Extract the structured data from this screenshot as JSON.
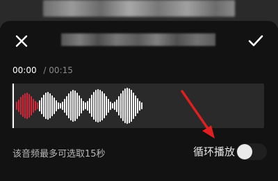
{
  "header": {
    "close_icon": "close-icon",
    "confirm_icon": "check-icon"
  },
  "time": {
    "current": "00:00",
    "separator": "/",
    "total": "00:15"
  },
  "waveform": {
    "played_color": "#d6283b",
    "unplayed_color": "#ffffff",
    "background": "#2a2a2a"
  },
  "footer": {
    "hint": "该音频最多可选取15秒",
    "loop_label": "循环播放",
    "loop_enabled": false
  },
  "annotation": {
    "arrow_color": "#e02020"
  }
}
